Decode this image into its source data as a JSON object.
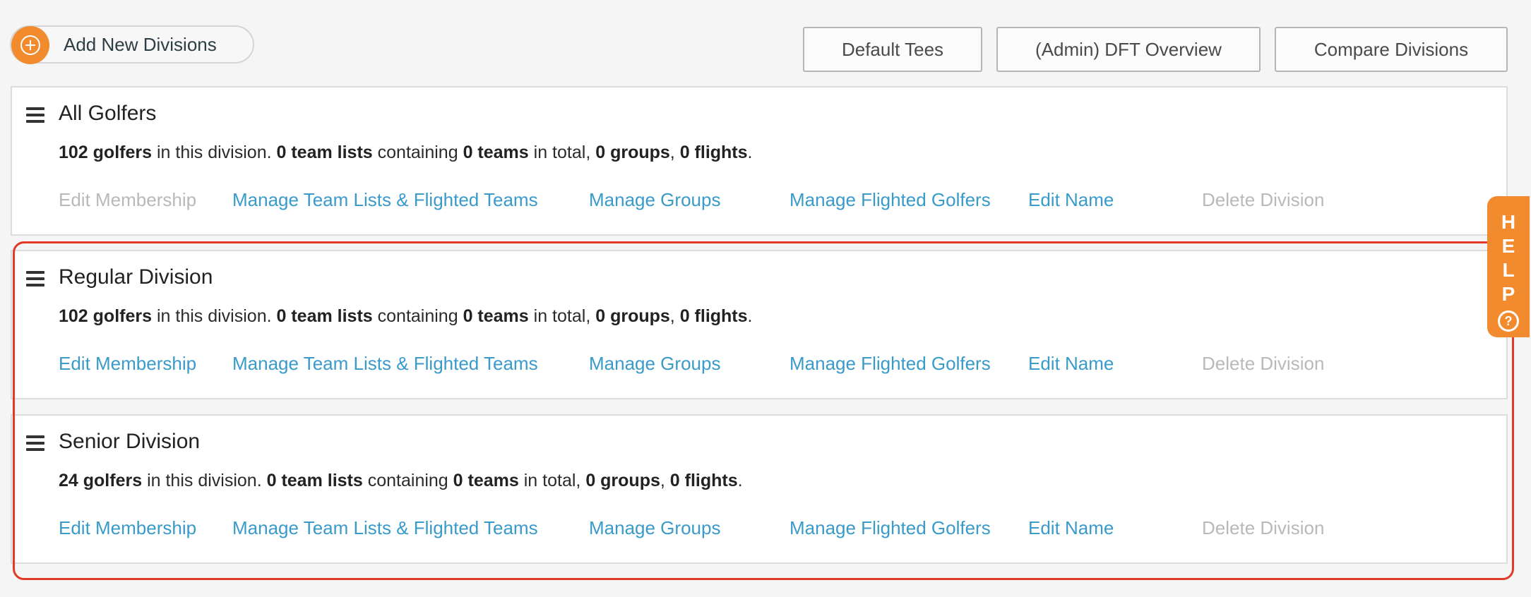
{
  "toolbar": {
    "add_label": "Add New Divisions",
    "default_tees": "Default Tees",
    "dft_overview": "(Admin) DFT Overview",
    "compare_divisions": "Compare Divisions"
  },
  "help": {
    "letters": "HELP",
    "question": "?"
  },
  "summary_words": {
    "in_division": "in this division.",
    "containing": "containing",
    "in_total": "in total,",
    "comma": ",",
    "period": "."
  },
  "link_labels": {
    "edit_membership": "Edit Membership",
    "manage_team_lists": "Manage Team Lists & Flighted Teams",
    "manage_groups": "Manage Groups",
    "manage_flighted_golfers": "Manage Flighted Golfers",
    "edit_name": "Edit Name",
    "delete_division": "Delete Division"
  },
  "divisions": [
    {
      "name": "All Golfers",
      "golfers": "102 golfers",
      "team_lists": "0 team lists",
      "teams": "0 teams",
      "groups": "0 groups",
      "flights": "0 flights",
      "edit_membership_enabled": false,
      "delete_enabled": false
    },
    {
      "name": "Regular Division",
      "golfers": "102 golfers",
      "team_lists": "0 team lists",
      "teams": "0 teams",
      "groups": "0 groups",
      "flights": "0 flights",
      "edit_membership_enabled": true,
      "delete_enabled": false
    },
    {
      "name": "Senior Division",
      "golfers": "24 golfers",
      "team_lists": "0 team lists",
      "teams": "0 teams",
      "groups": "0 groups",
      "flights": "0 flights",
      "edit_membership_enabled": true,
      "delete_enabled": false
    }
  ],
  "colors": {
    "accent_orange": "#f28a2e",
    "link_blue": "#3a9ac9",
    "disabled_gray": "#b9b9b9",
    "highlight_red": "#e23a26"
  }
}
